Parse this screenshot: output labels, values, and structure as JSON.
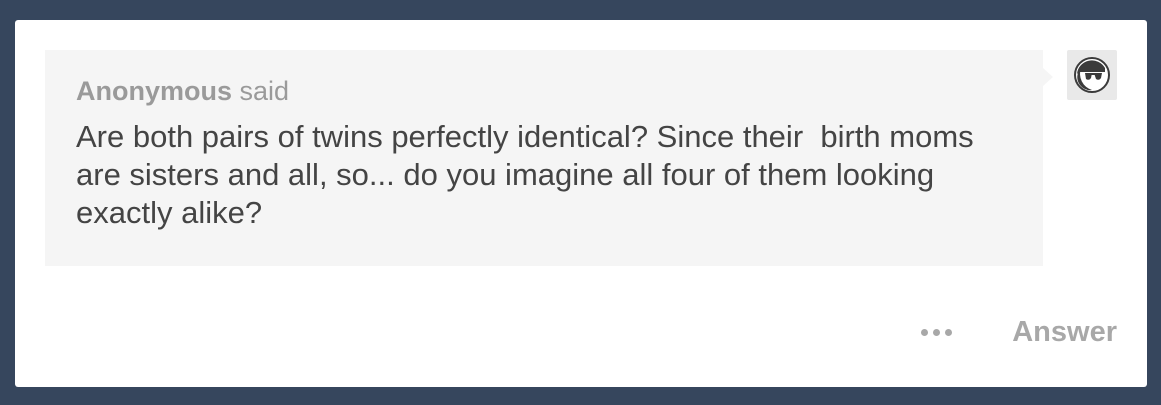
{
  "post": {
    "asker": {
      "name": "Anonymous",
      "verb": "said"
    },
    "question": "Are both pairs of twins perfectly identical? Since their  birth moms are sisters and all, so... do you imagine all four of them looking exactly alike?",
    "avatar_icon": "anonymous-sunglasses-icon"
  },
  "footer": {
    "more_icon": "more-options-icon",
    "answer_label": "Answer"
  },
  "colors": {
    "background": "#36465d",
    "card": "#ffffff",
    "bubble": "#f5f5f5",
    "muted_text": "#9a9a9a",
    "body_text": "#444444"
  }
}
